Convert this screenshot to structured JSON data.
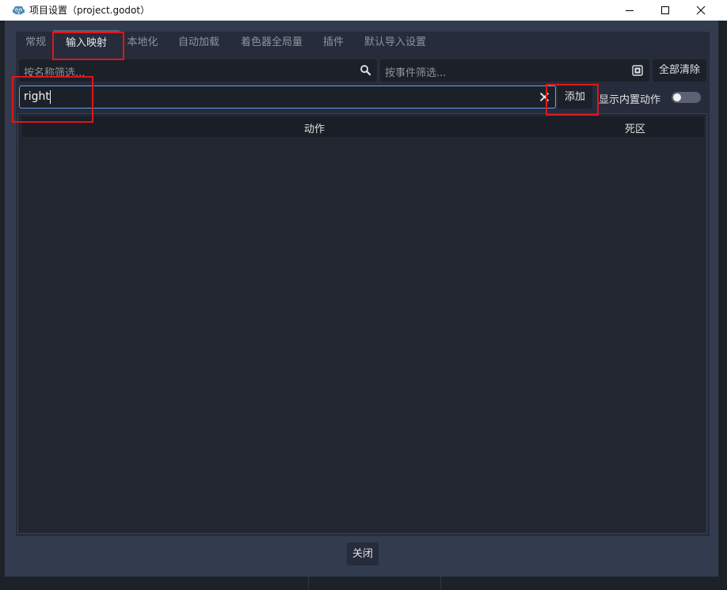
{
  "window": {
    "title": "项目设置（project.godot）",
    "icon": "godot-logo-icon"
  },
  "tabs": [
    {
      "label": "常规"
    },
    {
      "label": "输入映射"
    },
    {
      "label": "本地化"
    },
    {
      "label": "自动加载"
    },
    {
      "label": "着色器全局量"
    },
    {
      "label": "插件"
    },
    {
      "label": "默认导入设置"
    }
  ],
  "active_tab": "输入映射",
  "filters": {
    "name_placeholder": "按名称筛选...",
    "event_placeholder": "按事件筛选...",
    "clear_all_label": "全部清除"
  },
  "add_action": {
    "value": "right",
    "add_label": "添加",
    "show_builtin_label": "显示内置动作",
    "show_builtin_on": false
  },
  "table": {
    "columns": [
      "动作",
      "死区"
    ]
  },
  "footer": {
    "close_label": "关闭"
  },
  "colors": {
    "accent": "#5aa3f0",
    "annotation": "#e0161a",
    "background": "#333b4f",
    "panel": "#262c3b"
  }
}
